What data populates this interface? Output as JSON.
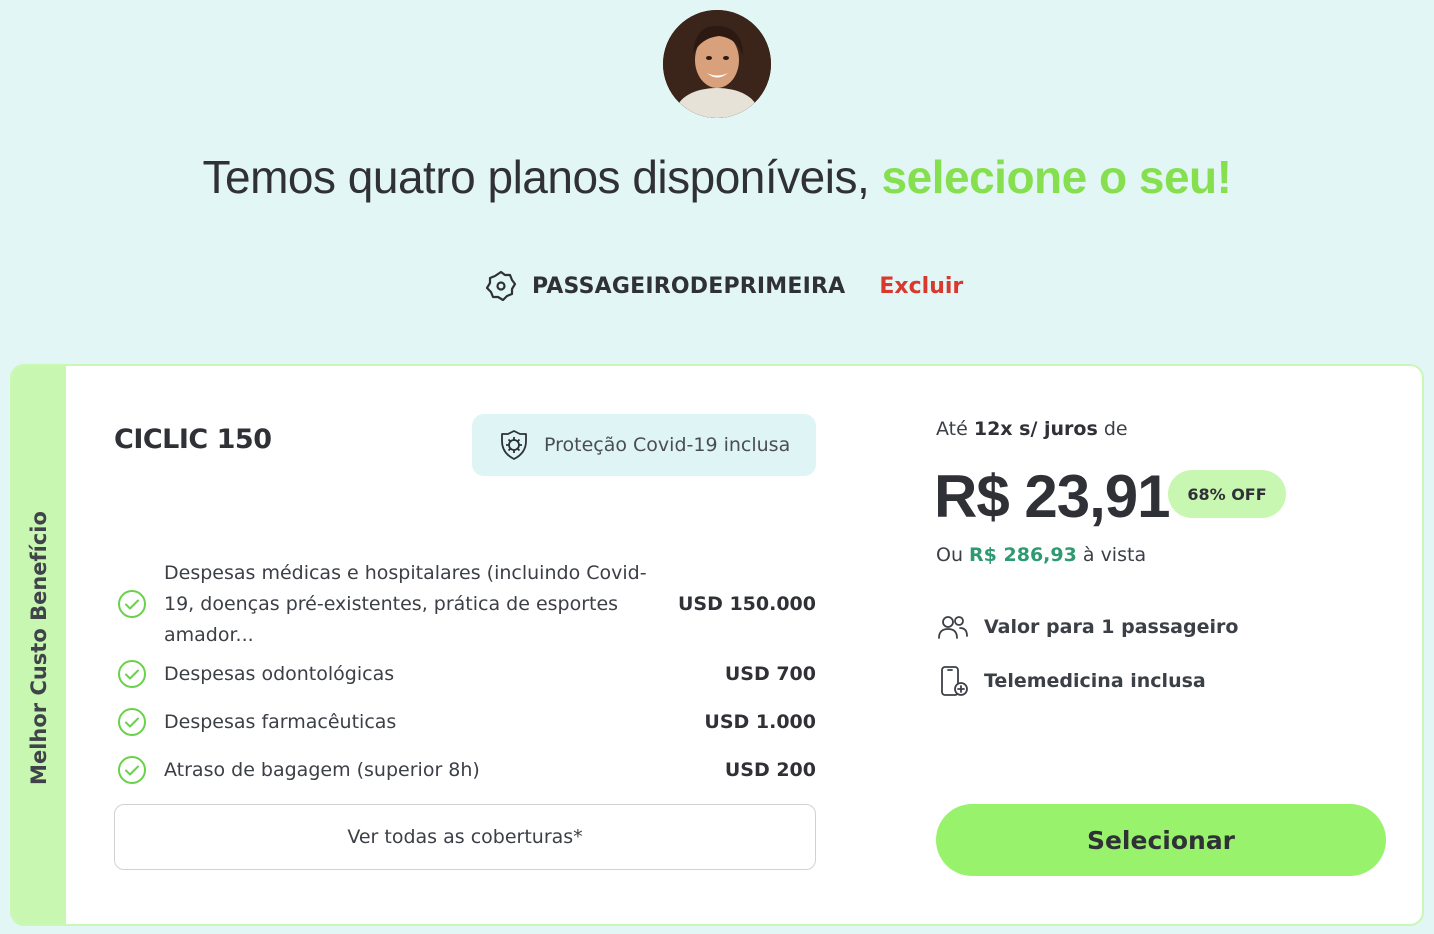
{
  "headline": {
    "text": "Temos quatro planos disponíveis, ",
    "accent": "selecione o seu!"
  },
  "coupon": {
    "icon": "tag-icon",
    "code": "PASSAGEIRODEPRIMEIRA",
    "remove_label": "Excluir"
  },
  "plan": {
    "ribbon": "Melhor Custo Benefício",
    "name": "CICLIC 150",
    "covid_badge": "Proteção Covid-19 inclusa",
    "coverages": [
      {
        "label": "Despesas médicas e hospitalares (incluindo Covid-19, doenças pré-existentes, prática de esportes amador...",
        "amount": "USD 150.000"
      },
      {
        "label": "Despesas odontológicas",
        "amount": "USD 700"
      },
      {
        "label": "Despesas farmacêuticas",
        "amount": "USD 1.000"
      },
      {
        "label": "Atraso de bagagem (superior 8h)",
        "amount": "USD 200"
      }
    ],
    "see_all_label": "Ver todas as coberturas*",
    "installments_prefix": "Até ",
    "installments_bold": "12x s/ juros",
    "installments_suffix": " de",
    "price": "R$ 23,91",
    "discount": "68% OFF",
    "cash_prefix": "Ou ",
    "cash_value": "R$ 286,93",
    "cash_suffix": " à vista",
    "features": [
      {
        "icon": "users-icon",
        "label": "Valor para 1 passageiro"
      },
      {
        "icon": "phone-medical-icon",
        "label": "Telemedicina inclusa"
      }
    ],
    "select_label": "Selecionar"
  },
  "colors": {
    "background": "#e3f6f6",
    "accent_green": "#86df4f",
    "button_green": "#98f26c",
    "remove_red": "#d9382c",
    "price_teal": "#2e9a72"
  }
}
